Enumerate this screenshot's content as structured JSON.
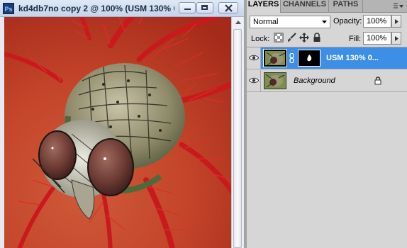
{
  "document": {
    "title": "kd4db7no copy 2 @ 100% (USM 130% 0...",
    "app_icon": "Ps"
  },
  "panel": {
    "tabs": [
      {
        "label": "LAYERS",
        "active": true
      },
      {
        "label": "CHANNELS",
        "active": false
      },
      {
        "label": "PATHS",
        "active": false
      }
    ],
    "blend_mode": "Normal",
    "opacity_label": "Opacity:",
    "opacity_value": "100%",
    "lock_label": "Lock:",
    "fill_label": "Fill:",
    "fill_value": "100%"
  },
  "layers": [
    {
      "name": "USM 130% 0...",
      "selected": true,
      "visible": true,
      "has_mask": true
    },
    {
      "name": "Background",
      "selected": false,
      "visible": true,
      "locked": true
    }
  ],
  "icons": {
    "app": "photoshop-icon",
    "minimize": "minimize-icon",
    "maximize": "maximize-icon",
    "close": "close-icon",
    "visibility": "eye-icon",
    "lock_transparent": "lock-transparent-pixels-icon",
    "lock_image": "brush-icon",
    "lock_position": "move-icon",
    "lock_all": "lock-icon",
    "link": "chain-link-icon",
    "panel_menu": "panel-menu-icon"
  },
  "colors": {
    "selected_layer": "#3d8ee6",
    "panel_bg": "#d6d6d6",
    "canvas_red": "#b83a22"
  }
}
